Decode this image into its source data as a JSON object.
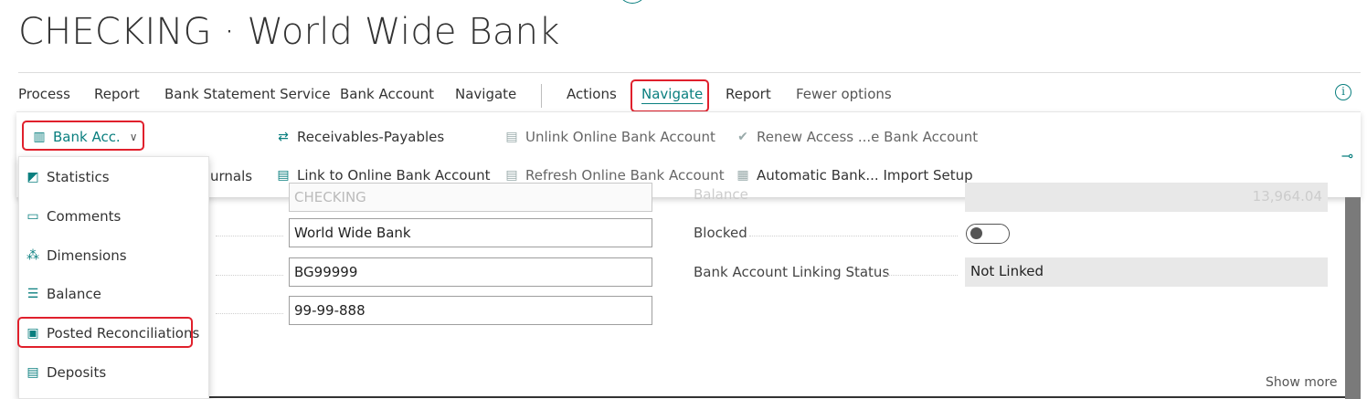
{
  "page": {
    "title": "CHECKING · World Wide Bank"
  },
  "menubar": {
    "items": [
      "Process",
      "Report",
      "Bank Statement Service",
      "Bank Account",
      "Navigate",
      "Actions",
      "Navigate",
      "Report",
      "Fewer options"
    ]
  },
  "actions": {
    "bank_acc": "Bank Acc.",
    "journals_partial": "urnals",
    "receivables_payables": "Receivables-Payables",
    "link_online": "Link to Online Bank Account",
    "unlink_online": "Unlink Online Bank Account",
    "refresh_online": "Refresh Online Bank Account",
    "renew_access": "Renew Access ...e Bank Account",
    "automatic_import": "Automatic Bank... Import Setup"
  },
  "dropdown": {
    "items": [
      "Statistics",
      "Comments",
      "Dimensions",
      "Balance",
      "Posted Reconciliations",
      "Deposits"
    ]
  },
  "form": {
    "no_value_partial": "CHECKING",
    "name_value": "World Wide Bank",
    "bank_branch_value": "BG99999",
    "bank_account_no_value": "99-99-888",
    "balance_label_partial": "Balance",
    "balance_value_partial": "13,964.04",
    "blocked_label": "Blocked",
    "linking_status_label": "Bank Account Linking Status",
    "linking_status_value": "Not Linked",
    "show_more": "Show more"
  },
  "colors": {
    "accent": "#0a7f7f",
    "highlight": "#e0202c"
  }
}
